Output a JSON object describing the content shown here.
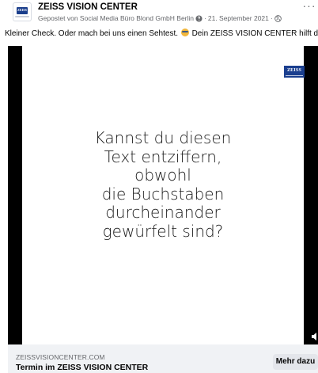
{
  "post": {
    "page_name": "ZEISS VISION CENTER",
    "posted_by": "Gepostet von Social Media Büro Blond GmbH Berlin",
    "separator": "·",
    "date": "21. September 2021",
    "separator2": "·",
    "more_label": "···",
    "verified_icon": "question-circle-icon",
    "audience_icon": "globe-icon",
    "avatar_text": "ZEISS",
    "caption_before": "Kleiner Check. Oder mach bei uns einen Sehtest.",
    "caption_after": "Dein ZEISS VISION CENTER hilft dir weiter.",
    "caption_emoji": "nerd-face-emoji"
  },
  "video": {
    "logo_text": "ZEISS",
    "lines": [
      "Kannst du diesen",
      "Text entziffern,",
      "obwohl",
      "die Buchstaben",
      "durcheinander",
      "gewürfelt sind?"
    ],
    "volume_icon": "speaker-icon"
  },
  "link": {
    "domain": "ZEISSVISIONCENTER.COM",
    "title": "Termin im ZEISS VISION CENTER",
    "cta_label": "Mehr dazu"
  },
  "colors": {
    "zeiss_blue": "#1b3f8f",
    "link_bar_bg": "#f0f2f5",
    "meta_gray": "#65676b"
  }
}
